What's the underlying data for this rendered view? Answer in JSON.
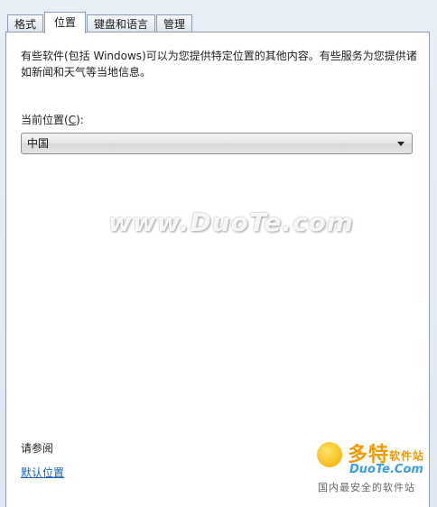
{
  "tabs": [
    {
      "label": "格式",
      "active": false
    },
    {
      "label": "位置",
      "active": true
    },
    {
      "label": "键盘和语言",
      "active": false
    },
    {
      "label": "管理",
      "active": false
    }
  ],
  "location": {
    "description": "有些软件(包括 Windows)可以为您提供特定位置的其他内容。有些服务为您提供诸如新闻和天气等当地信息。",
    "label_prefix": "当前位置(",
    "label_accel": "C",
    "label_suffix": "):",
    "selected": "中国"
  },
  "see_also": {
    "heading": "请参阅",
    "link": "默认位置"
  },
  "watermark": "www.DuoTe.com",
  "logo": {
    "brand": "多特",
    "brand_suffix": "软件站",
    "url": "DuoTe.Com",
    "slogan": "国内最安全的软件站"
  },
  "colors": {
    "link": "#1a5fb4",
    "brand": "#f29a00",
    "brand_url": "#3aa0e0"
  }
}
